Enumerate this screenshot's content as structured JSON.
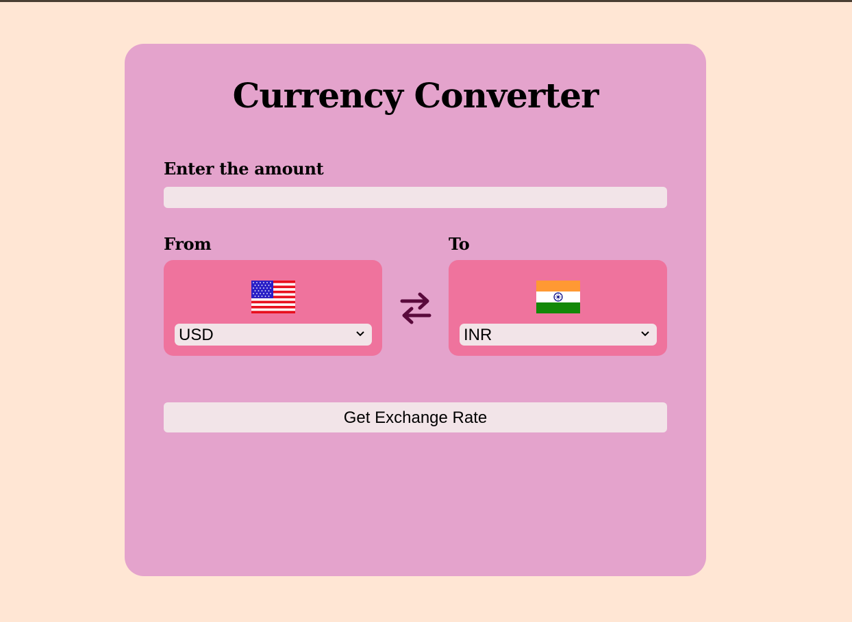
{
  "header": {
    "title": "Currency Converter"
  },
  "amount": {
    "label": "Enter the amount",
    "value": "",
    "placeholder": ""
  },
  "from": {
    "label": "From",
    "selected": "USD",
    "flag_icon": "us-flag-icon"
  },
  "to": {
    "label": "To",
    "selected": "INR",
    "flag_icon": "india-flag-icon"
  },
  "swap": {
    "icon": "swap-arrows-icon",
    "color": "#5A0A3C"
  },
  "actions": {
    "exchange_button_label": "Get Exchange Rate"
  },
  "colors": {
    "page_background": "#FFE6D4",
    "card_background": "#E4A3CC",
    "select_panel": "#EF739D",
    "input_background": "#F2E4E8"
  }
}
